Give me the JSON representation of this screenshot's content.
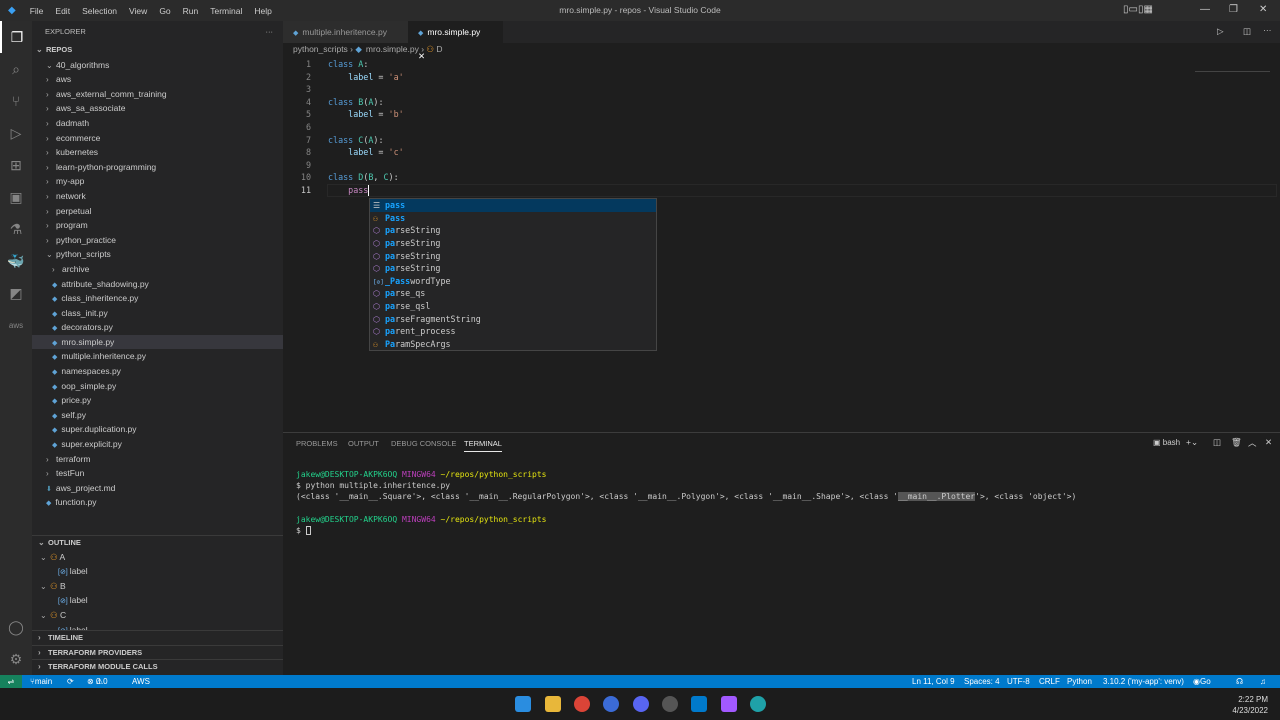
{
  "window": {
    "title": "mro.simple.py - repos - Visual Studio Code",
    "menu": [
      "File",
      "Edit",
      "Selection",
      "View",
      "Go",
      "Run",
      "Terminal",
      "Help"
    ]
  },
  "sidebar": {
    "header": "EXPLORER",
    "root": "REPOS",
    "items": [
      {
        "label": "40_algorithms",
        "type": "folder",
        "depth": 0,
        "open": true
      },
      {
        "label": "aws",
        "type": "folder",
        "depth": 0
      },
      {
        "label": "aws_external_comm_training",
        "type": "folder",
        "depth": 0
      },
      {
        "label": "aws_sa_associate",
        "type": "folder",
        "depth": 0
      },
      {
        "label": "dadmath",
        "type": "folder",
        "depth": 0
      },
      {
        "label": "ecommerce",
        "type": "folder",
        "depth": 0
      },
      {
        "label": "kubernetes",
        "type": "folder",
        "depth": 0
      },
      {
        "label": "learn-python-programming",
        "type": "folder",
        "depth": 0
      },
      {
        "label": "my-app",
        "type": "folder",
        "depth": 0
      },
      {
        "label": "network",
        "type": "folder",
        "depth": 0
      },
      {
        "label": "perpetual",
        "type": "folder",
        "depth": 0
      },
      {
        "label": "program",
        "type": "folder",
        "depth": 0
      },
      {
        "label": "python_practice",
        "type": "folder",
        "depth": 0
      },
      {
        "label": "python_scripts",
        "type": "folder",
        "depth": 0,
        "open": true
      },
      {
        "label": "archive",
        "type": "folder",
        "depth": 1
      },
      {
        "label": "attribute_shadowing.py",
        "type": "py",
        "depth": 1
      },
      {
        "label": "class_inheritence.py",
        "type": "py",
        "depth": 1
      },
      {
        "label": "class_init.py",
        "type": "py",
        "depth": 1
      },
      {
        "label": "decorators.py",
        "type": "py",
        "depth": 1
      },
      {
        "label": "mro.simple.py",
        "type": "py",
        "depth": 1,
        "selected": true
      },
      {
        "label": "multiple.inheritence.py",
        "type": "py",
        "depth": 1
      },
      {
        "label": "namespaces.py",
        "type": "py",
        "depth": 1
      },
      {
        "label": "oop_simple.py",
        "type": "py",
        "depth": 1
      },
      {
        "label": "price.py",
        "type": "py",
        "depth": 1
      },
      {
        "label": "self.py",
        "type": "py",
        "depth": 1
      },
      {
        "label": "super.duplication.py",
        "type": "py",
        "depth": 1
      },
      {
        "label": "super.explicit.py",
        "type": "py",
        "depth": 1
      },
      {
        "label": "terraform",
        "type": "folder",
        "depth": 0
      },
      {
        "label": "testFun",
        "type": "folder",
        "depth": 0
      },
      {
        "label": "aws_project.md",
        "type": "md",
        "depth": 0
      },
      {
        "label": "function.py",
        "type": "py",
        "depth": 0
      }
    ],
    "outline_header": "OUTLINE",
    "outline": [
      {
        "label": "A",
        "kind": "class"
      },
      {
        "label": "label",
        "kind": "var"
      },
      {
        "label": "B",
        "kind": "class"
      },
      {
        "label": "label",
        "kind": "var"
      },
      {
        "label": "C",
        "kind": "class"
      },
      {
        "label": "label",
        "kind": "var"
      }
    ],
    "sections": [
      "TIMELINE",
      "TERRAFORM PROVIDERS",
      "TERRAFORM MODULE CALLS"
    ]
  },
  "tabs": [
    {
      "label": "multiple.inheritence.py",
      "active": false
    },
    {
      "label": "mro.simple.py",
      "active": true
    }
  ],
  "breadcrumb": [
    "python_scripts",
    "mro.simple.py",
    "D"
  ],
  "code": [
    [
      [
        "kw",
        "class "
      ],
      [
        "cls",
        "A"
      ],
      [
        "",
        ":"
      ]
    ],
    [
      [
        "",
        "    "
      ],
      [
        "var",
        "label"
      ],
      [
        "",
        " = "
      ],
      [
        "str",
        "'a'"
      ]
    ],
    [],
    [
      [
        "kw",
        "class "
      ],
      [
        "cls",
        "B"
      ],
      [
        "",
        "("
      ],
      [
        "cls",
        "A"
      ],
      [
        "",
        "):"
      ]
    ],
    [
      [
        "",
        "    "
      ],
      [
        "var",
        "label"
      ],
      [
        "",
        " = "
      ],
      [
        "str",
        "'b'"
      ]
    ],
    [],
    [
      [
        "kw",
        "class "
      ],
      [
        "cls",
        "C"
      ],
      [
        "",
        "("
      ],
      [
        "cls",
        "A"
      ],
      [
        "",
        "):"
      ]
    ],
    [
      [
        "",
        "    "
      ],
      [
        "var",
        "label"
      ],
      [
        "",
        " = "
      ],
      [
        "str",
        "'c'"
      ]
    ],
    [],
    [
      [
        "kw",
        "class "
      ],
      [
        "cls",
        "D"
      ],
      [
        "",
        "("
      ],
      [
        "cls",
        "B"
      ],
      [
        "",
        ", "
      ],
      [
        "cls",
        "C"
      ],
      [
        "",
        "):"
      ]
    ],
    [
      [
        "",
        "    "
      ],
      [
        "kw2",
        "pass"
      ]
    ]
  ],
  "suggestions": [
    {
      "label": "pass",
      "icon": "keyword",
      "match": "pass"
    },
    {
      "label": "Pass",
      "icon": "class",
      "match": "Pass"
    },
    {
      "label": "parseString",
      "icon": "method",
      "match": "pa"
    },
    {
      "label": "parseString",
      "icon": "method",
      "match": "pa"
    },
    {
      "label": "parseString",
      "icon": "method",
      "match": "pa"
    },
    {
      "label": "parseString",
      "icon": "method",
      "match": "pa"
    },
    {
      "label": "_PasswordType",
      "icon": "variable",
      "match": "_Pass"
    },
    {
      "label": "parse_qs",
      "icon": "method",
      "match": "pa"
    },
    {
      "label": "parse_qsl",
      "icon": "method",
      "match": "pa"
    },
    {
      "label": "parseFragmentString",
      "icon": "method",
      "match": "pa"
    },
    {
      "label": "parent_process",
      "icon": "method",
      "match": "pa"
    },
    {
      "label": "ParamSpecArgs",
      "icon": "class",
      "match": "Pa"
    }
  ],
  "panel": {
    "tabs": [
      "PROBLEMS",
      "OUTPUT",
      "DEBUG CONSOLE",
      "TERMINAL"
    ],
    "active": "TERMINAL",
    "shell": "bash",
    "prompt": {
      "user": "jakew@DESKTOP-AKPK6OQ",
      "sys": "MINGW64",
      "path": "~/repos/python_scripts"
    },
    "command": "$ python multiple.inheritence.py",
    "output_pre": "(<class '__main__.Square'>, <class '__main__.RegularPolygon'>, <class '__main__.Polygon'>, <class '__main__.Shape'>, <class '",
    "output_hl": "__main__.Plotter",
    "output_post": "'>, <class 'object'>)",
    "prompt2": "$ "
  },
  "status": {
    "branch": "main",
    "errors": "0",
    "warnings": "0",
    "aws": "AWS",
    "position": "Ln 11, Col 9",
    "spaces": "Spaces: 4",
    "encoding": "UTF-8",
    "eol": "CRLF",
    "language": "Python",
    "interpreter": "3.10.2 ('my-app': venv)",
    "golive": "Go Live"
  },
  "taskbar": {
    "time": "2:22 PM",
    "date": "4/23/2022"
  },
  "colors": {
    "accent": "#007acc",
    "statusRemote": "#16825d"
  }
}
